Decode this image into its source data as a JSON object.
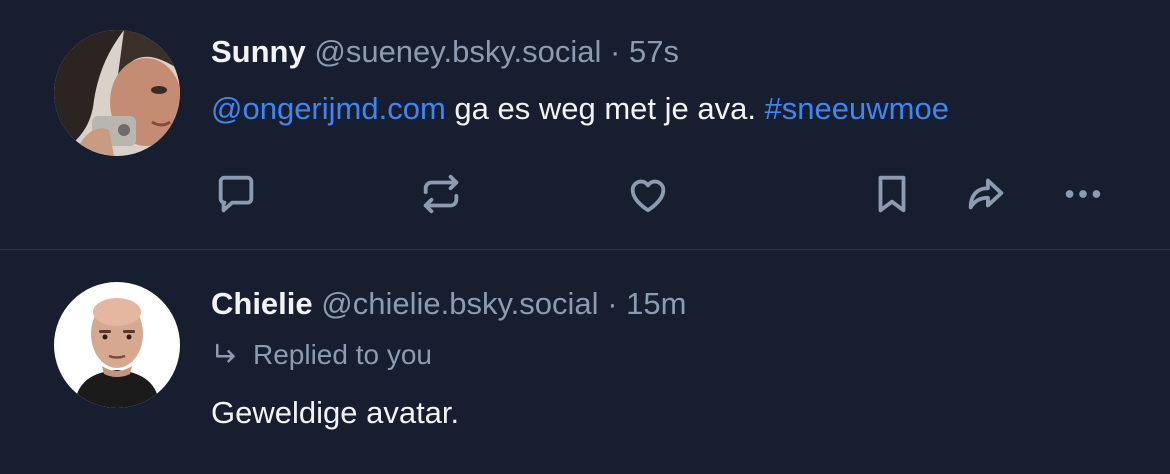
{
  "posts": [
    {
      "author_name": "Sunny",
      "handle": "@sueney.bsky.social",
      "separator": "·",
      "time": "57s",
      "text_parts": {
        "mention": "@ongerijmd.com",
        "body": " ga es weg met je ava. ",
        "hashtag": "#sneeuwmoe"
      },
      "actions": [
        "reply-icon",
        "repost-icon",
        "like-icon",
        "bookmark-icon",
        "share-icon",
        "more-icon"
      ]
    },
    {
      "author_name": "Chielie",
      "handle": "@chielie.bsky.social",
      "separator": "·",
      "time": "15m",
      "reply_context": "Replied to you",
      "text": "Geweldige avatar."
    }
  ],
  "colors": {
    "background": "#161e2f",
    "text": "#f1f3f5",
    "muted": "#8d9bb1",
    "link": "#3f86f4",
    "divider": "#27334a"
  }
}
